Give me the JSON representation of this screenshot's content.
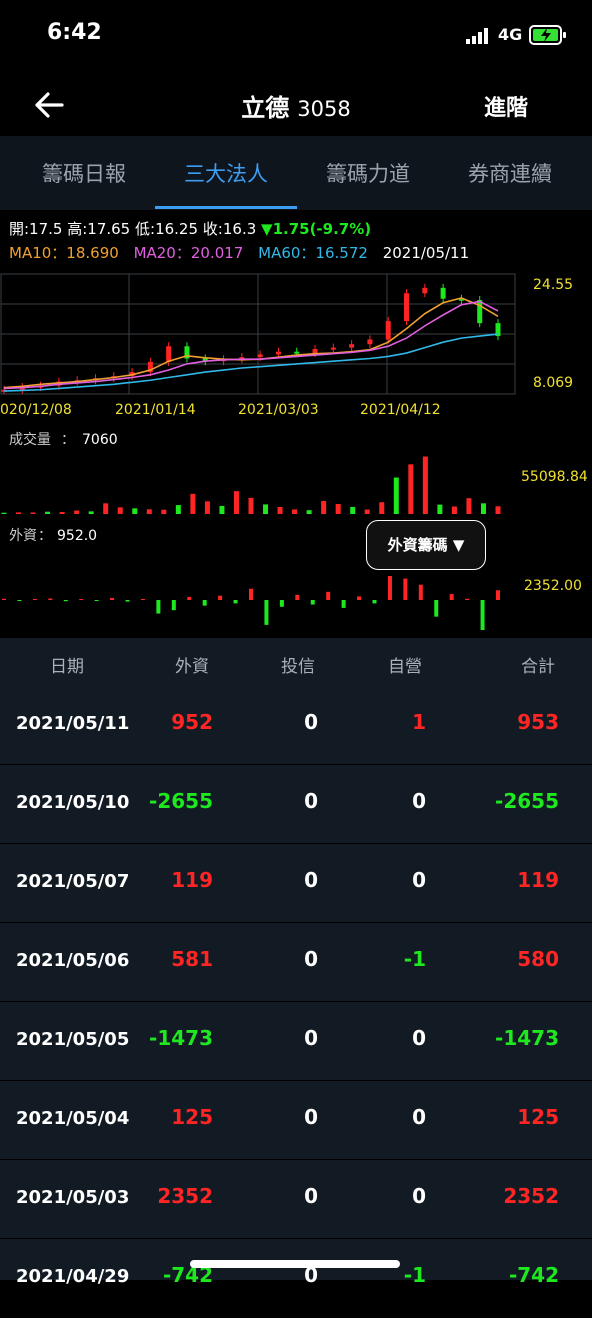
{
  "status_bar": {
    "time": "6:42",
    "network": "4G"
  },
  "header": {
    "title": "立德",
    "code": "3058",
    "advanced_label": "進階"
  },
  "tabs": [
    {
      "label": "籌碼日報",
      "active": false
    },
    {
      "label": "三大法人",
      "active": true
    },
    {
      "label": "籌碼力道",
      "active": false
    },
    {
      "label": "券商連續",
      "active": false
    }
  ],
  "quote": {
    "open_label": "開:17.5",
    "high_label": "高:17.65",
    "low_label": "低:16.25",
    "close_label": "收:16.3",
    "change_label": "▼1.75(-9.7%)",
    "ma10_label": "MA10：18.690",
    "ma20_label": "MA20：20.017",
    "ma60_label": "MA60：16.572",
    "date": "2021/05/11"
  },
  "colors": {
    "up": "#ff2525",
    "down": "#1ee81e",
    "ma10": "#f0a030",
    "ma20": "#e060e0",
    "ma60": "#30b8e8",
    "accent": "#3d9df2"
  },
  "chart_data": [
    {
      "type": "candlestick",
      "title": "",
      "x_ticks": [
        "020/12/08",
        "2021/01/14",
        "2021/03/03",
        "2021/04/12"
      ],
      "y_ticks": [
        "24.55",
        "8.069"
      ],
      "ylim": [
        8.069,
        24.55
      ],
      "series": [
        {
          "name": "MA10",
          "values": [
            8.7,
            8.9,
            9.2,
            9.4,
            9.6,
            9.9,
            10.2,
            10.6,
            11.3,
            12.6,
            13.4,
            13.1,
            12.9,
            12.8,
            12.9,
            13.2,
            13.5,
            13.7,
            13.8,
            14.0,
            14.3,
            15.4,
            17.4,
            19.6,
            21.2,
            21.9,
            20.8,
            19.2
          ]
        },
        {
          "name": "MA20",
          "values": [
            8.6,
            8.7,
            8.9,
            9.2,
            9.4,
            9.6,
            9.9,
            10.2,
            10.6,
            11.3,
            12.2,
            12.6,
            12.8,
            12.9,
            12.9,
            13.1,
            13.3,
            13.5,
            13.7,
            13.9,
            14.2,
            14.8,
            16.0,
            17.8,
            19.4,
            20.9,
            21.4,
            20.0
          ]
        },
        {
          "name": "MA60",
          "values": [
            8.2,
            8.3,
            8.4,
            8.6,
            8.8,
            9.0,
            9.2,
            9.5,
            9.8,
            10.2,
            10.6,
            11.0,
            11.3,
            11.6,
            11.8,
            12.0,
            12.2,
            12.4,
            12.6,
            12.8,
            13.0,
            13.3,
            13.8,
            14.6,
            15.4,
            16.0,
            16.3,
            16.6
          ]
        },
        {
          "name": "price",
          "values": [
            8.4,
            8.8,
            9.0,
            9.6,
            9.8,
            10.1,
            10.4,
            11.0,
            12.5,
            14.8,
            13.0,
            12.6,
            12.9,
            13.2,
            13.6,
            14.0,
            13.8,
            14.4,
            14.6,
            15.1,
            15.8,
            18.5,
            22.6,
            23.4,
            21.8,
            21.6,
            18.2,
            16.3
          ]
        }
      ]
    },
    {
      "type": "bar",
      "title": "成交量",
      "value_label": "7060",
      "y_ticks": [
        "55098.84"
      ],
      "ylim": [
        0,
        55098.84
      ],
      "values": [
        1200,
        1500,
        1400,
        2100,
        1800,
        3200,
        2400,
        9800,
        6100,
        5200,
        4300,
        3900,
        8200,
        18500,
        11600,
        7400,
        21000,
        14800,
        8800,
        6400,
        4200,
        3500,
        12000,
        9200,
        6500,
        4100,
        10800,
        33500,
        45600,
        52800,
        8600,
        6900,
        14500,
        9800,
        7060
      ]
    },
    {
      "type": "bar",
      "title": "外資",
      "value_label": "952.0",
      "y_ticks": [
        "2352.00"
      ],
      "ylim": [
        -2655,
        2352
      ],
      "values": [
        120,
        -80,
        60,
        150,
        -110,
        90,
        -60,
        200,
        -140,
        80,
        -1200,
        -900,
        300,
        -500,
        420,
        -300,
        1100,
        -2200,
        -600,
        500,
        -400,
        800,
        -700,
        350,
        -300,
        2352,
        2100,
        1500,
        -1473,
        581,
        119,
        -2655,
        952
      ]
    }
  ],
  "chip_dropdown_label": "外資籌碼 ▼",
  "table": {
    "headers": [
      "日期",
      "外資",
      "投信",
      "自營",
      "合計"
    ],
    "rows": [
      {
        "date": "2021/05/11",
        "foreign": "952",
        "trust": "0",
        "dealer": "1",
        "total": "953"
      },
      {
        "date": "2021/05/10",
        "foreign": "-2655",
        "trust": "0",
        "dealer": "0",
        "total": "-2655"
      },
      {
        "date": "2021/05/07",
        "foreign": "119",
        "trust": "0",
        "dealer": "0",
        "total": "119"
      },
      {
        "date": "2021/05/06",
        "foreign": "581",
        "trust": "0",
        "dealer": "-1",
        "total": "580"
      },
      {
        "date": "2021/05/05",
        "foreign": "-1473",
        "trust": "0",
        "dealer": "0",
        "total": "-1473"
      },
      {
        "date": "2021/05/04",
        "foreign": "125",
        "trust": "0",
        "dealer": "0",
        "total": "125"
      },
      {
        "date": "2021/05/03",
        "foreign": "2352",
        "trust": "0",
        "dealer": "0",
        "total": "2352"
      },
      {
        "date": "2021/04/29",
        "foreign": "-742",
        "trust": "0",
        "dealer": "-1",
        "total": "-742"
      }
    ]
  }
}
